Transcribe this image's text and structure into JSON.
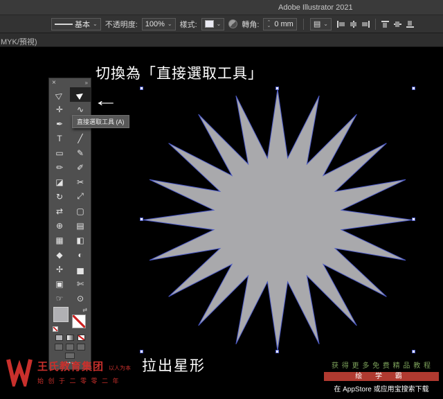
{
  "title_bar": {
    "title": "Adobe Illustrator 2021"
  },
  "control_bar": {
    "stroke_profile": {
      "value": "基本"
    },
    "opacity_label": "不透明度:",
    "opacity_value": "100%",
    "style_label": "樣式:",
    "corner_label": "轉角:",
    "corner_value": "0 mm",
    "align_icons": [
      {
        "name": "align-left-icon",
        "type": "left"
      },
      {
        "name": "align-h-center-icon",
        "type": "hcenter"
      },
      {
        "name": "align-right-icon",
        "type": "right"
      },
      {
        "name": "align-top-icon",
        "type": "top"
      },
      {
        "name": "align-v-center-icon",
        "type": "vcenter"
      },
      {
        "name": "align-bottom-icon",
        "type": "bottom"
      }
    ]
  },
  "document_tab": {
    "text": "MYK/預視)"
  },
  "annotations": {
    "heading": "切換為「直接選取工具」",
    "caption": "拉出星形",
    "arrow_glyph": "←"
  },
  "tooltip": {
    "text": "直接選取工具 (A)"
  },
  "toolbar": {
    "close_glyph": "×",
    "collapse_glyph": "»",
    "overflow_glyph": "•••",
    "fill_color": "#b1b1b4",
    "tools": [
      {
        "name": "selection-tool",
        "icon": "selection-arrow-icon",
        "glyph": "▷",
        "rotate": true
      },
      {
        "name": "direct-selection-tool",
        "icon": "direct-selection-arrow-icon",
        "glyph": "▶",
        "rotate": true,
        "selected": true
      },
      {
        "name": "magic-wand-tool",
        "icon": "magic-wand-icon",
        "glyph": "✛"
      },
      {
        "name": "lasso-tool",
        "icon": "lasso-icon",
        "glyph": "∿"
      },
      {
        "name": "pen-tool",
        "icon": "pen-icon",
        "glyph": "✒"
      },
      {
        "name": "curvature-tool",
        "icon": "curvature-icon",
        "glyph": "✑"
      },
      {
        "name": "type-tool",
        "icon": "type-icon",
        "glyph": "T"
      },
      {
        "name": "line-segment-tool",
        "icon": "line-icon",
        "glyph": "╱"
      },
      {
        "name": "rectangle-tool",
        "icon": "rectangle-icon",
        "glyph": "▭"
      },
      {
        "name": "paintbrush-tool",
        "icon": "paintbrush-icon",
        "glyph": "✎"
      },
      {
        "name": "pencil-tool",
        "icon": "pencil-icon",
        "glyph": "✏"
      },
      {
        "name": "shaper-tool",
        "icon": "shaper-icon",
        "glyph": "✐"
      },
      {
        "name": "eraser-tool",
        "icon": "eraser-icon",
        "glyph": "◪"
      },
      {
        "name": "scissors-tool",
        "icon": "scissors-icon",
        "glyph": "✂"
      },
      {
        "name": "rotate-tool",
        "icon": "rotate-icon",
        "glyph": "↻"
      },
      {
        "name": "scale-tool",
        "icon": "scale-icon",
        "glyph": "⤢"
      },
      {
        "name": "width-tool",
        "icon": "width-icon",
        "glyph": "⇄"
      },
      {
        "name": "free-transform-tool",
        "icon": "free-transform-icon",
        "glyph": "▢"
      },
      {
        "name": "shape-builder-tool",
        "icon": "shape-builder-icon",
        "glyph": "⊕"
      },
      {
        "name": "perspective-grid-tool",
        "icon": "perspective-grid-icon",
        "glyph": "▤"
      },
      {
        "name": "mesh-tool",
        "icon": "mesh-icon",
        "glyph": "▦"
      },
      {
        "name": "gradient-tool",
        "icon": "gradient-icon",
        "glyph": "◧"
      },
      {
        "name": "eyedropper-tool",
        "icon": "eyedropper-icon",
        "glyph": "◆"
      },
      {
        "name": "blend-tool",
        "icon": "blend-icon",
        "glyph": "◐"
      },
      {
        "name": "symbol-sprayer-tool",
        "icon": "symbol-sprayer-icon",
        "glyph": "✢"
      },
      {
        "name": "graph-tool",
        "icon": "graph-icon",
        "glyph": "▅"
      },
      {
        "name": "artboard-tool",
        "icon": "artboard-icon",
        "glyph": "▣"
      },
      {
        "name": "slice-tool",
        "icon": "slice-icon",
        "glyph": "✄"
      },
      {
        "name": "hand-tool",
        "icon": "hand-icon",
        "glyph": "☞"
      },
      {
        "name": "zoom-tool",
        "icon": "zoom-icon",
        "glyph": "⊙"
      }
    ],
    "color_buttons": [
      {
        "name": "fill-color-icon",
        "type": "solid"
      },
      {
        "name": "gradient-icon",
        "type": "grad"
      },
      {
        "name": "none-icon",
        "type": "none"
      }
    ],
    "draw_mode_buttons": [
      {
        "name": "draw-normal-icon"
      },
      {
        "name": "draw-behind-icon"
      },
      {
        "name": "draw-inside-icon"
      }
    ]
  },
  "star": {
    "points": 20,
    "inner_ratio": 0.48,
    "fill": "#a9a9ac",
    "stroke": "#4a58c4"
  },
  "watermarks": {
    "left": {
      "brand": "王氏教育集团",
      "slogan": "以人为本",
      "founded": "始 创 于 二 零 零 二 年"
    },
    "right": {
      "line1": "获 得 更 多 免 费 精 品 教 程",
      "line2": "绘 学 霸",
      "line3": "在 AppStore 或应用宝搜索下载"
    }
  }
}
